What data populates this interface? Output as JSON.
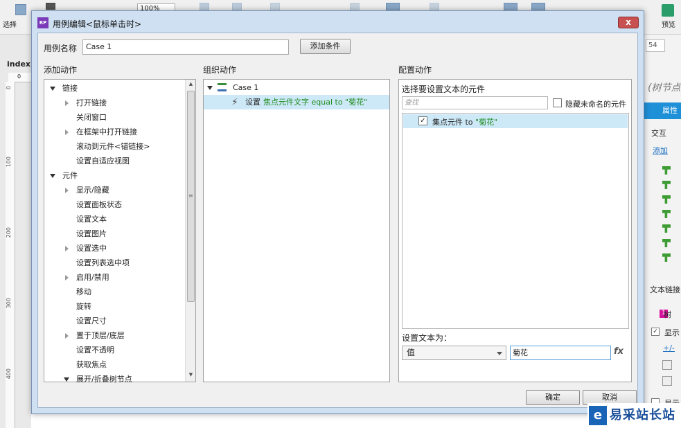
{
  "toolbar": {
    "select_label": "选择",
    "zoom_value": "100%",
    "preview_label": "预览"
  },
  "canvas": {
    "tab_label": "index",
    "ruler_top": "0",
    "ruler_left": [
      "0",
      "100",
      "200",
      "300",
      "400"
    ]
  },
  "right_panel": {
    "field_value": "54",
    "title": "(树节点",
    "tab_props": "属性",
    "section_interact": "交互",
    "add_link": "添加",
    "text_link": "文本链接",
    "tree_label": "树",
    "tree_badge": "1",
    "show_label": "显示",
    "plus_minus": "+/-",
    "show2_label": "显示"
  },
  "dialog": {
    "icon_text": "RP",
    "title": "用例编辑<鼠标单击时>",
    "case_name_label": "用例名称",
    "case_name_value": "Case 1",
    "add_condition_button": "添加条件",
    "add_action_header": "添加动作",
    "organize_action_header": "组织动作",
    "configure_action_header": "配置动作",
    "action_tree": [
      {
        "label": "链接",
        "level": 0,
        "arrow": "open"
      },
      {
        "label": "打开链接",
        "level": 1,
        "arrow": "closed"
      },
      {
        "label": "关闭窗口",
        "level": 1,
        "arrow": "none"
      },
      {
        "label": "在框架中打开链接",
        "level": 1,
        "arrow": "closed"
      },
      {
        "label": "滚动到元件<锚链接>",
        "level": 1,
        "arrow": "none"
      },
      {
        "label": "设置自适应视图",
        "level": 1,
        "arrow": "none"
      },
      {
        "label": "元件",
        "level": 0,
        "arrow": "open"
      },
      {
        "label": "显示/隐藏",
        "level": 1,
        "arrow": "closed"
      },
      {
        "label": "设置面板状态",
        "level": 1,
        "arrow": "none"
      },
      {
        "label": "设置文本",
        "level": 1,
        "arrow": "none"
      },
      {
        "label": "设置图片",
        "level": 1,
        "arrow": "none"
      },
      {
        "label": "设置选中",
        "level": 1,
        "arrow": "closed"
      },
      {
        "label": "设置列表选中项",
        "level": 1,
        "arrow": "none"
      },
      {
        "label": "启用/禁用",
        "level": 1,
        "arrow": "closed"
      },
      {
        "label": "移动",
        "level": 1,
        "arrow": "none"
      },
      {
        "label": "旋转",
        "level": 1,
        "arrow": "none"
      },
      {
        "label": "设置尺寸",
        "level": 1,
        "arrow": "none"
      },
      {
        "label": "置于顶层/底层",
        "level": 1,
        "arrow": "closed"
      },
      {
        "label": "设置不透明",
        "level": 1,
        "arrow": "none"
      },
      {
        "label": "获取焦点",
        "level": 1,
        "arrow": "none"
      },
      {
        "label": "展开/折叠树节点",
        "level": 1,
        "arrow": "open"
      }
    ],
    "case_node_label": "Case 1",
    "action_prefix": "设置",
    "action_detail": "焦点元件文字 equal to \"菊花\"",
    "select_widget_label": "选择要设置文本的元件",
    "search_placeholder": "查找",
    "hide_unnamed_label": "隐藏未命名的元件",
    "widget_row_label": "集点元件 to \"菊花\"",
    "widget_row_prefix": "集点元件 to ",
    "widget_row_value": "\"菊花\"",
    "widget_checked": "✓",
    "set_text_label": "设置文本为：",
    "value_type": "值",
    "text_value": "菊花",
    "fx_label": "fx",
    "ok_button": "确定",
    "cancel_button": "取消",
    "close_symbol": "x"
  },
  "watermark": {
    "logo_char": "e",
    "text": "易采站长站"
  },
  "colors": {
    "accent_blue": "#1e90d8",
    "highlight": "#cde8f7",
    "green_text": "#1b8a1b",
    "dialog_frame": "#cfe0f2"
  }
}
